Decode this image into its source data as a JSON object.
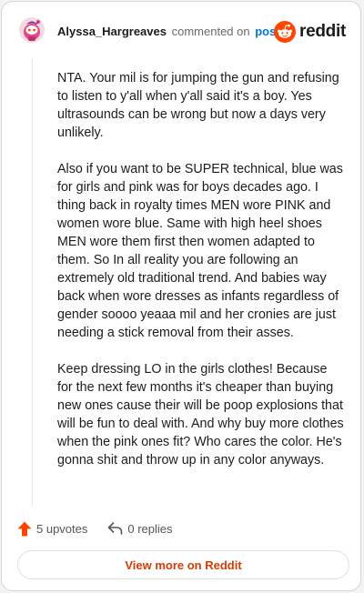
{
  "header": {
    "username": "Alyssa_Hargreaves",
    "action_text": "commented on",
    "post_link": "post",
    "brand_name": "reddit"
  },
  "comment": {
    "paragraphs": [
      "NTA. Your mil is for jumping the gun and refusing to listen to y'all when y'all said it's a boy. Yes ultrasounds can be wrong but now a days very unlikely.",
      "Also if you want to be SUPER technical, blue was for girls and pink was for boys decades ago. I thing back in royalty times MEN wore PINK and women wore blue. Same with high heel shoes MEN wore them first then women adapted to them. So In all reality you are following an extremely old traditional trend. And babies way back when wore dresses as infants regardless of gender soooo yeaaa mil and her cronies are just needing a stick removal from their asses.",
      "Keep dressing LO in the girls clothes! Because for the next few months it's cheaper than buying new ones cause their will be poop explosions that will be fun to deal with. And why buy more clothes when the pink ones fit? Who cares the color. He's gonna shit and throw up in any color anyways."
    ]
  },
  "footer": {
    "upvotes": "5 upvotes",
    "replies": "0 replies",
    "view_more": "View more on Reddit"
  },
  "icons": {
    "avatar": "snoo-avatar-icon",
    "brand": "reddit-logo-icon",
    "upvote": "upvote-arrow-icon",
    "reply": "reply-arrow-icon"
  },
  "colors": {
    "link": "#0079d3",
    "brand_orange": "#ff4500",
    "view_more_text": "#d93a00",
    "upvote": "#ff4500"
  }
}
